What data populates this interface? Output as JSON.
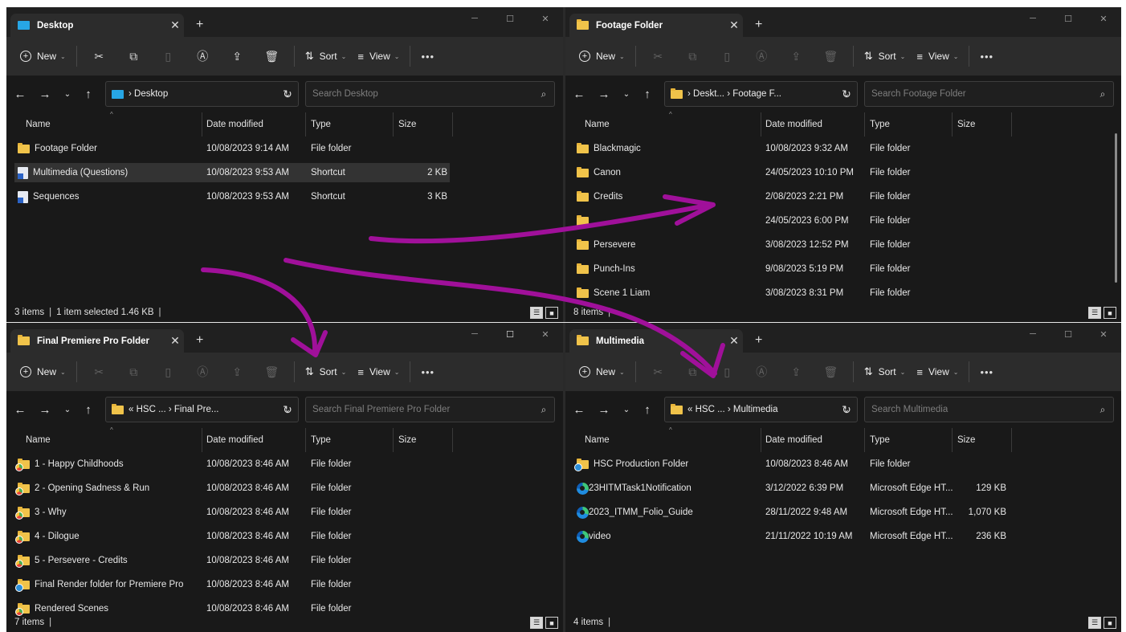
{
  "toolbar_common": {
    "new_label": "New",
    "sort_label": "Sort",
    "view_label": "View",
    "more_label": "•••"
  },
  "columns": {
    "name": "Name",
    "date": "Date modified",
    "type": "Type",
    "size": "Size"
  },
  "windows": [
    {
      "tab_title": "Desktop",
      "address": "› Desktop",
      "search_placeholder": "Search Desktop",
      "status_count": "3 items",
      "status_selection": "1 item selected  1.46 KB",
      "items": [
        {
          "name": "Footage Folder",
          "date": "10/08/2023 9:14 AM",
          "type": "File folder",
          "size": "",
          "icon": "folder-icon"
        },
        {
          "name": "Multimedia (Questions)",
          "date": "10/08/2023 9:53 AM",
          "type": "Shortcut",
          "size": "2 KB",
          "icon": "shortcut-icon",
          "selected": true
        },
        {
          "name": "Sequences",
          "date": "10/08/2023 9:53 AM",
          "type": "Shortcut",
          "size": "3 KB",
          "icon": "shortcut-icon"
        }
      ]
    },
    {
      "tab_title": "Footage Folder",
      "address": "› Deskt... › Footage F...",
      "search_placeholder": "Search Footage Folder",
      "status_count": "8 items",
      "items": [
        {
          "name": "Blackmagic",
          "date": "10/08/2023 9:32 AM",
          "type": "File folder",
          "size": "",
          "icon": "folder-icon"
        },
        {
          "name": "Canon",
          "date": "24/05/2023 10:10 PM",
          "type": "File folder",
          "size": "",
          "icon": "folder-icon"
        },
        {
          "name": "Credits",
          "date": "2/08/2023 2:21 PM",
          "type": "File folder",
          "size": "",
          "icon": "folder-icon"
        },
        {
          "name": "",
          "date": "24/05/2023 6:00 PM",
          "type": "File folder",
          "size": "",
          "icon": "folder-icon"
        },
        {
          "name": "Persevere",
          "date": "3/08/2023 12:52 PM",
          "type": "File folder",
          "size": "",
          "icon": "folder-icon"
        },
        {
          "name": "Punch-Ins",
          "date": "9/08/2023 5:19 PM",
          "type": "File folder",
          "size": "",
          "icon": "folder-icon"
        },
        {
          "name": "Scene 1 Liam",
          "date": "3/08/2023 8:31 PM",
          "type": "File folder",
          "size": "",
          "icon": "folder-icon"
        }
      ]
    },
    {
      "tab_title": "Final Premiere Pro Folder",
      "address": "« HSC ... › Final Pre...",
      "search_placeholder": "Search Final Premiere Pro Folder",
      "status_count": "7 items",
      "items": [
        {
          "name": "1 - Happy Childhoods",
          "date": "10/08/2023 8:46 AM",
          "type": "File folder",
          "size": "",
          "icon": "sync-folder-icon"
        },
        {
          "name": "2 - Opening Sadness & Run",
          "date": "10/08/2023 8:46 AM",
          "type": "File folder",
          "size": "",
          "icon": "sync-folder-icon"
        },
        {
          "name": "3 - Why",
          "date": "10/08/2023 8:46 AM",
          "type": "File folder",
          "size": "",
          "icon": "sync-folder-icon"
        },
        {
          "name": "4 - Dilogue",
          "date": "10/08/2023 8:46 AM",
          "type": "File folder",
          "size": "",
          "icon": "sync-folder-icon"
        },
        {
          "name": "5 - Persevere - Credits",
          "date": "10/08/2023 8:46 AM",
          "type": "File folder",
          "size": "",
          "icon": "sync-folder-icon"
        },
        {
          "name": "Final Render folder for Premiere Pro",
          "date": "10/08/2023 8:46 AM",
          "type": "File folder",
          "size": "",
          "icon": "sync-folder-icon"
        },
        {
          "name": "Rendered Scenes",
          "date": "10/08/2023 8:46 AM",
          "type": "File folder",
          "size": "",
          "icon": "sync-folder-icon"
        }
      ]
    },
    {
      "tab_title": "Multimedia",
      "address": "« HSC ... › Multimedia",
      "search_placeholder": "Search Multimedia",
      "status_count": "4 items",
      "items": [
        {
          "name": "HSC Production Folder",
          "date": "10/08/2023 8:46 AM",
          "type": "File folder",
          "size": "",
          "icon": "sync-folder-icon"
        },
        {
          "name": "23HITMTask1Notification",
          "date": "3/12/2022 6:39 PM",
          "type": "Microsoft Edge HT...",
          "size": "129 KB",
          "icon": "edge-icon"
        },
        {
          "name": "2023_ITMM_Folio_Guide",
          "date": "28/11/2022 9:48 AM",
          "type": "Microsoft Edge HT...",
          "size": "1,070 KB",
          "icon": "edge-icon"
        },
        {
          "name": "video",
          "date": "21/11/2022 10:19 AM",
          "type": "Microsoft Edge HT...",
          "size": "236 KB",
          "icon": "edge-icon"
        }
      ]
    }
  ],
  "annotation_color": "#a0109a"
}
